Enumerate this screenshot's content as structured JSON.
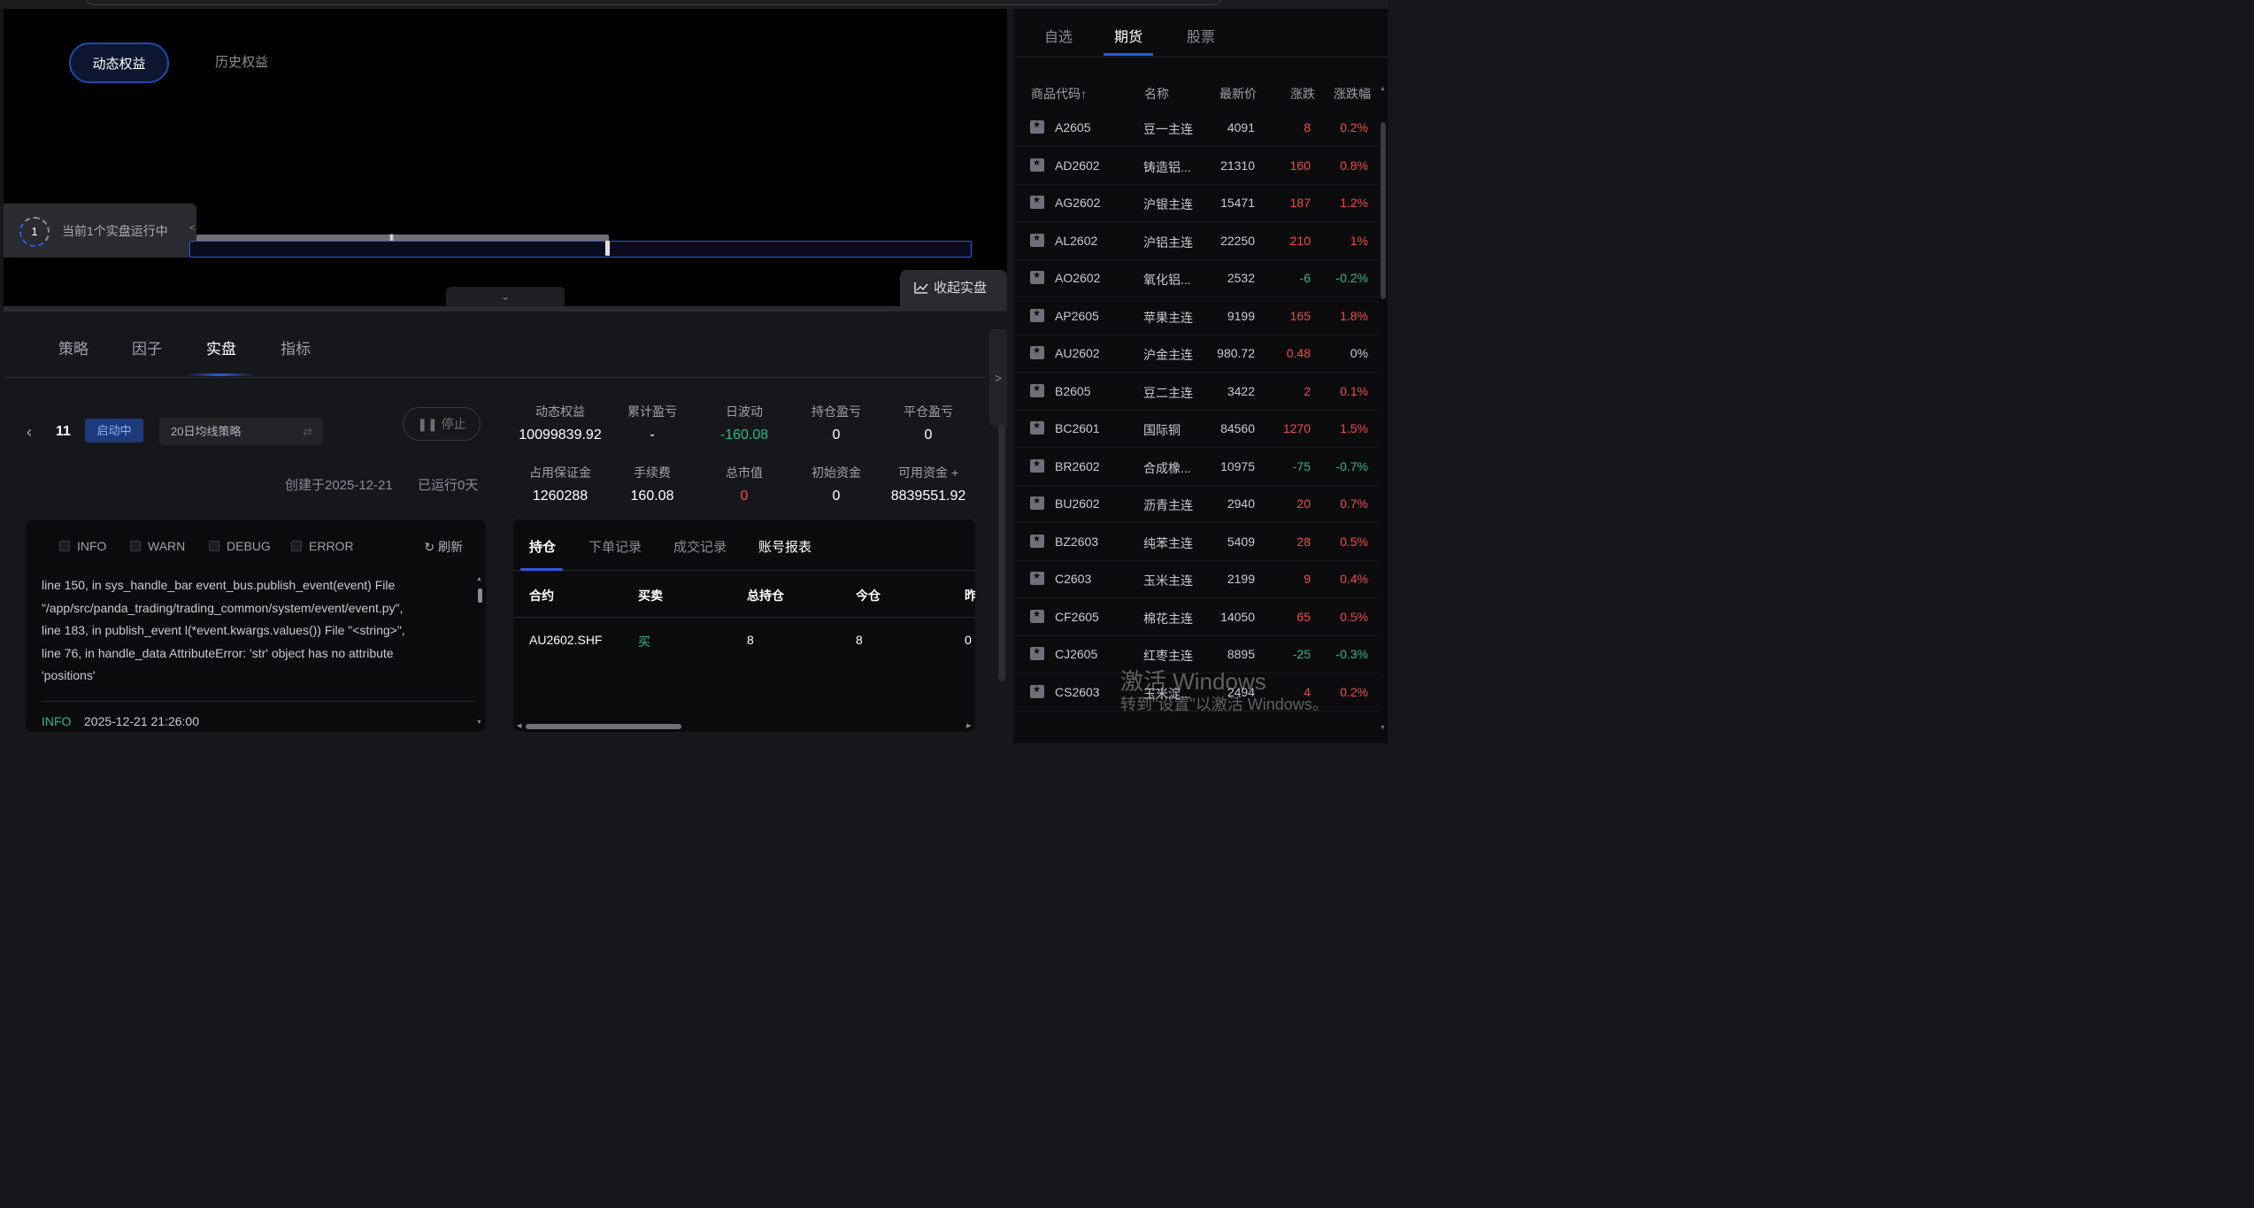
{
  "chart_panel": {
    "tabs": [
      "动态权益",
      "历史权益"
    ],
    "run_status": {
      "count": "1",
      "text": "当前1个实盘运行中"
    },
    "collapse_button": "收起实盘"
  },
  "main_tabs": [
    "策略",
    "因子",
    "实盘",
    "指标"
  ],
  "active_main_tab": "实盘",
  "strategy": {
    "id": "11",
    "status": "启动中",
    "name": "20日均线策略",
    "stop_label": "停止",
    "created": "创建于2025-12-21",
    "runtime": "已运行0天"
  },
  "metrics": [
    {
      "label": "动态权益",
      "value": "10099839.92",
      "color": "#ffffff"
    },
    {
      "label": "累计盈亏",
      "value": "-",
      "color": "#ffffff"
    },
    {
      "label": "日波动",
      "value": "-160.08",
      "color": "#2eb88a"
    },
    {
      "label": "持仓盈亏",
      "value": "0",
      "color": "#ffffff"
    },
    {
      "label": "平仓盈亏",
      "value": "0",
      "color": "#ffffff"
    },
    {
      "label": "占用保证金",
      "value": "1260288",
      "color": "#ffffff"
    },
    {
      "label": "手续费",
      "value": "160.08",
      "color": "#ffffff"
    },
    {
      "label": "总市值",
      "value": "0",
      "color": "#f04a4a"
    },
    {
      "label": "初始资金",
      "value": "0",
      "color": "#ffffff"
    },
    {
      "label": "可用资金 +",
      "value": "8839551.92",
      "color": "#ffffff"
    }
  ],
  "log": {
    "filters": [
      "INFO",
      "WARN",
      "DEBUG",
      "ERROR"
    ],
    "refresh": "刷新",
    "lines": [
      "line 150, in sys_handle_bar event_bus.publish_event(event) File",
      "\"/app/src/panda_trading/trading_common/system/event/event.py\",",
      "line 183, in publish_event l(*event.kwargs.values()) File \"<string>\",",
      "line 76, in handle_data AttributeError: 'str' object has no attribute",
      "'positions'"
    ],
    "last_level": "INFO",
    "last_time": "2025-12-21 21:26:00"
  },
  "positions": {
    "tabs": [
      "持仓",
      "下单记录",
      "成交记录",
      "账号报表"
    ],
    "headers": [
      "合约",
      "买卖",
      "总持仓",
      "今仓",
      "昨"
    ],
    "rows": [
      [
        "AU2602.SHF",
        "买",
        "8",
        "8",
        "0"
      ]
    ]
  },
  "watchlist": {
    "tabs": [
      "自选",
      "期货",
      "股票"
    ],
    "active_tab": "期货",
    "headers": [
      "商品代码↑",
      "名称",
      "最新价",
      "涨跌",
      "涨跌幅"
    ],
    "rows": [
      {
        "code": "A2605",
        "name": "豆一主连",
        "price": "4091",
        "chg": "8",
        "pct": "0.2%",
        "dir": "up"
      },
      {
        "code": "AD2602",
        "name": "铸造铝...",
        "price": "21310",
        "chg": "160",
        "pct": "0.8%",
        "dir": "up"
      },
      {
        "code": "AG2602",
        "name": "沪银主连",
        "price": "15471",
        "chg": "187",
        "pct": "1.2%",
        "dir": "up"
      },
      {
        "code": "AL2602",
        "name": "沪铝主连",
        "price": "22250",
        "chg": "210",
        "pct": "1%",
        "dir": "up"
      },
      {
        "code": "AO2602",
        "name": "氧化铝...",
        "price": "2532",
        "chg": "-6",
        "pct": "-0.2%",
        "dir": "dn"
      },
      {
        "code": "AP2605",
        "name": "苹果主连",
        "price": "9199",
        "chg": "165",
        "pct": "1.8%",
        "dir": "up"
      },
      {
        "code": "AU2602",
        "name": "沪金主连",
        "price": "980.72",
        "chg": "0.48",
        "pct": "0%",
        "dir": "up",
        "pct_dir": "flat"
      },
      {
        "code": "B2605",
        "name": "豆二主连",
        "price": "3422",
        "chg": "2",
        "pct": "0.1%",
        "dir": "up"
      },
      {
        "code": "BC2601",
        "name": "国际铜",
        "price": "84560",
        "chg": "1270",
        "pct": "1.5%",
        "dir": "up"
      },
      {
        "code": "BR2602",
        "name": "合成橡...",
        "price": "10975",
        "chg": "-75",
        "pct": "-0.7%",
        "dir": "dn"
      },
      {
        "code": "BU2602",
        "name": "沥青主连",
        "price": "2940",
        "chg": "20",
        "pct": "0.7%",
        "dir": "up"
      },
      {
        "code": "BZ2603",
        "name": "纯苯主连",
        "price": "5409",
        "chg": "28",
        "pct": "0.5%",
        "dir": "up"
      },
      {
        "code": "C2603",
        "name": "玉米主连",
        "price": "2199",
        "chg": "9",
        "pct": "0.4%",
        "dir": "up"
      },
      {
        "code": "CF2605",
        "name": "棉花主连",
        "price": "14050",
        "chg": "65",
        "pct": "0.5%",
        "dir": "up"
      },
      {
        "code": "CJ2605",
        "name": "红枣主连",
        "price": "8895",
        "chg": "-25",
        "pct": "-0.3%",
        "dir": "dn"
      },
      {
        "code": "CS2603",
        "name": "玉米淀...",
        "price": "2494",
        "chg": "4",
        "pct": "0.2%",
        "dir": "up"
      }
    ]
  },
  "watermark": {
    "line1": "激活 Windows",
    "line2": "转到\"设置\"以激活 Windows。"
  }
}
